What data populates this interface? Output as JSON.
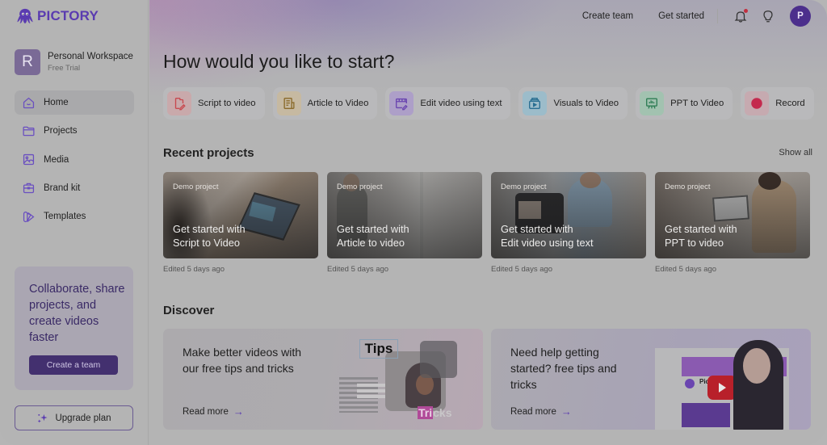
{
  "brand": {
    "name": "PICTORY",
    "color": "#5a3bb0"
  },
  "workspace": {
    "initial": "R",
    "name": "Personal Workspace",
    "plan": "Free Trial"
  },
  "sidebar": {
    "items": [
      {
        "label": "Home",
        "icon": "home-icon",
        "active": true
      },
      {
        "label": "Projects",
        "icon": "folder-icon",
        "active": false
      },
      {
        "label": "Media",
        "icon": "image-icon",
        "active": false
      },
      {
        "label": "Brand kit",
        "icon": "briefcase-icon",
        "active": false
      },
      {
        "label": "Templates",
        "icon": "swatch-icon",
        "active": false
      }
    ],
    "promo": {
      "text": "Collaborate, share projects, and create videos faster",
      "button": "Create a team"
    },
    "upgrade": {
      "label": "Upgrade plan",
      "icon": "sparkle-icon"
    }
  },
  "topbar": {
    "links": [
      "Create team",
      "Get started"
    ],
    "icons": [
      "bell-icon",
      "lightbulb-icon"
    ],
    "user_initial": "P"
  },
  "main": {
    "title": "How would you like to start?",
    "start_options": [
      {
        "label": "Script to video",
        "icon": "script-icon",
        "color": "#c8484e",
        "bg": "#c9a9ab"
      },
      {
        "label": "Article to Video",
        "icon": "article-icon",
        "color": "#8a6a2a",
        "bg": "#c6b9a1"
      },
      {
        "label": "Edit video using text",
        "icon": "edit-video-icon",
        "color": "#6a45b0",
        "bg": "#ad9fc8"
      },
      {
        "label": "Visuals to Video",
        "icon": "visuals-icon",
        "color": "#2a6f92",
        "bg": "#9cbcca"
      },
      {
        "label": "PPT to Video",
        "icon": "presentation-icon",
        "color": "#2e7d55",
        "bg": "#a2c2b0"
      },
      {
        "label": "Record",
        "icon": "record-icon",
        "color": "#c42a4e",
        "bg": "#c6aab0"
      }
    ],
    "recent": {
      "title": "Recent projects",
      "show_all": "Show all",
      "projects": [
        {
          "tag": "Demo project",
          "line1": "Get started with",
          "line2": "Script to Video",
          "edited": "Edited 5 days ago"
        },
        {
          "tag": "Demo project",
          "line1": "Get started with",
          "line2": "Article to video",
          "edited": "Edited 5 days ago"
        },
        {
          "tag": "Demo project",
          "line1": "Get started with",
          "line2": "Edit video using text",
          "edited": "Edited 5 days ago"
        },
        {
          "tag": "Demo project",
          "line1": "Get started with",
          "line2": "PPT to video",
          "edited": "Edited 5 days ago"
        }
      ]
    },
    "discover": {
      "title": "Discover",
      "cards": [
        {
          "text": "Make better videos with our free tips and tricks",
          "link": "Read more",
          "art_label_1": "Tips",
          "art_label_2a": "Tri",
          "art_label_2b": "cks"
        },
        {
          "text": "Need help getting started? free tips and tricks",
          "link": "Read more",
          "art_label": "Pictory"
        }
      ]
    }
  }
}
